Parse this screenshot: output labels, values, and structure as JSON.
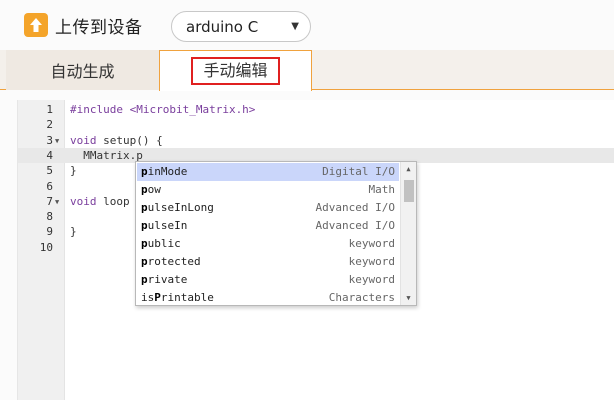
{
  "toolbar": {
    "upload_label": "上传到设备",
    "upload_icon": "upload-arrow-icon",
    "board_select": {
      "value": "arduino C",
      "arrow": "▼"
    }
  },
  "tabs": [
    {
      "label": "自动生成",
      "active": false
    },
    {
      "label": "手动编辑",
      "active": true
    }
  ],
  "editor": {
    "lines": [
      {
        "num": "1",
        "fold": "",
        "text": "#include <Microbit_Matrix.h>"
      },
      {
        "num": "2",
        "fold": "",
        "text": ""
      },
      {
        "num": "3",
        "fold": "▼",
        "text": "void setup() {"
      },
      {
        "num": "4",
        "fold": "",
        "text": "  MMatrix.p",
        "active": true
      },
      {
        "num": "5",
        "fold": "",
        "text": "}"
      },
      {
        "num": "6",
        "fold": "",
        "text": ""
      },
      {
        "num": "7",
        "fold": "▼",
        "text": "void loop"
      },
      {
        "num": "8",
        "fold": "",
        "text": ""
      },
      {
        "num": "9",
        "fold": "",
        "text": "}"
      },
      {
        "num": "10",
        "fold": "",
        "text": ""
      }
    ]
  },
  "autocomplete": {
    "items": [
      {
        "match": "p",
        "rest": "inMode",
        "type": "Digital I/O",
        "selected": true
      },
      {
        "match": "p",
        "rest": "ow",
        "type": "Math"
      },
      {
        "match": "p",
        "rest": "ulseInLong",
        "type": "Advanced I/O"
      },
      {
        "match": "p",
        "rest": "ulseIn",
        "type": "Advanced I/O"
      },
      {
        "match": "p",
        "rest": "ublic",
        "type": "keyword"
      },
      {
        "match": "p",
        "rest": "rotected",
        "type": "keyword"
      },
      {
        "match": "p",
        "rest": "rivate",
        "type": "keyword"
      },
      {
        "prefix": "is",
        "match": "P",
        "rest": "rintable",
        "type": "Characters"
      }
    ],
    "scroll_up": "▲",
    "scroll_down": "▼"
  },
  "colors": {
    "accent_orange": "#f4a42a",
    "tab_border": "#f0a23e",
    "highlight_red": "#e02020",
    "keyword_purple": "#7a3e9d",
    "selection_blue": "#cad6fa"
  }
}
